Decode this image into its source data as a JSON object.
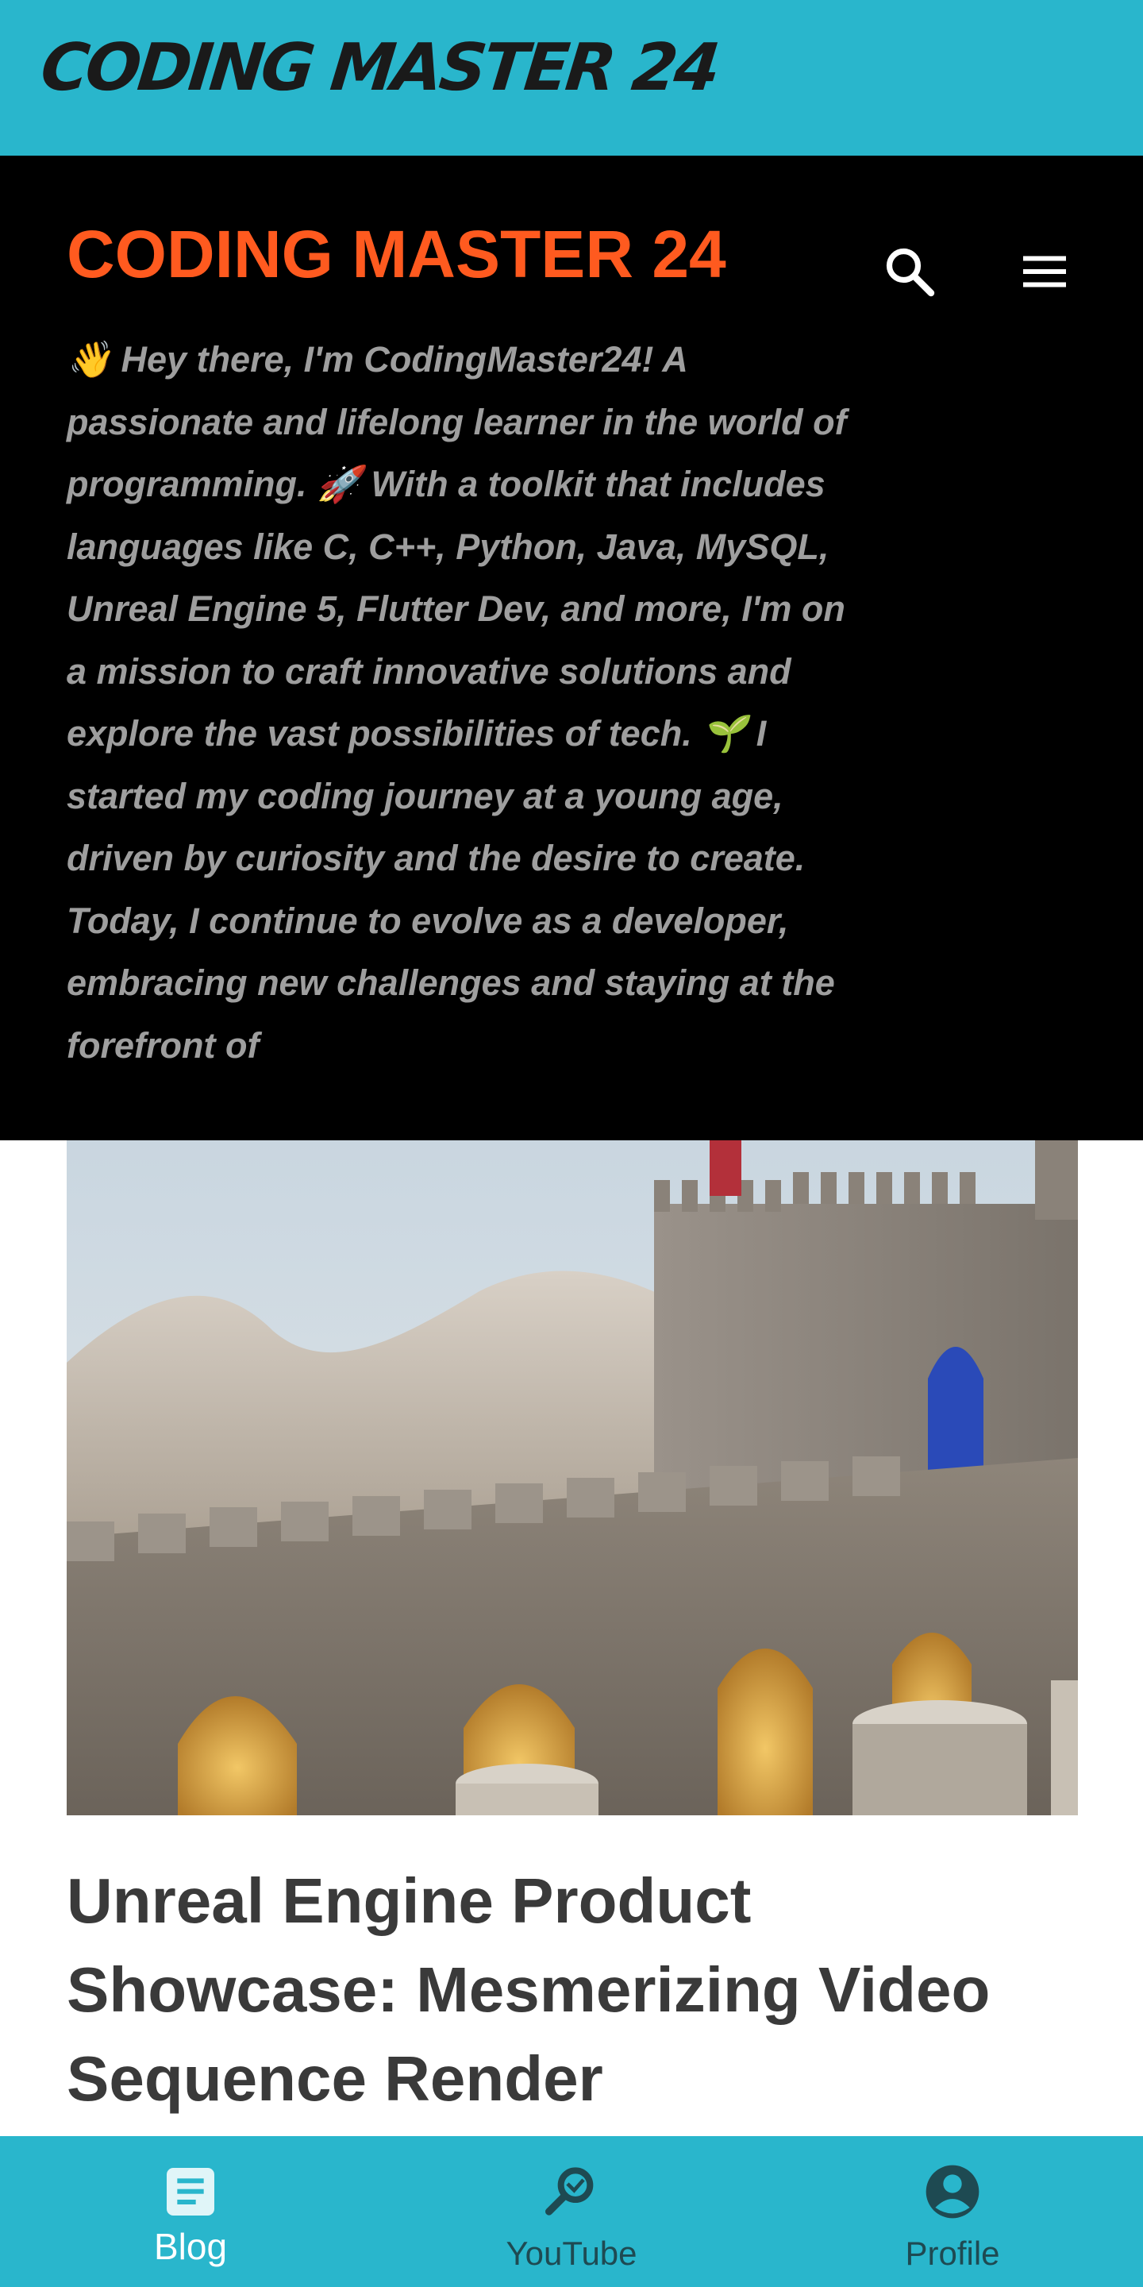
{
  "app_bar": {
    "title": "CODING MASTER 24",
    "background_color": "#29b6cc"
  },
  "hero": {
    "blog_title": "CODING MASTER 24",
    "title_color": "#ff5a1f",
    "description": "👋 Hey there, I'm CodingMaster24! A passionate and lifelong learner in the world of programming. 🚀 With a toolkit that includes languages like C, C++, Python, Java, MySQL, Unreal Engine 5, Flutter Dev, and more, I'm on a mission to craft innovative solutions and explore the vast possibilities of tech.  🌱 I started my coding journey at a young age, driven by curiosity and the desire to create. Today, I continue to evolve as a developer, embracing new challenges and staying at the forefront of",
    "icons": [
      "search-icon",
      "menu-icon"
    ]
  },
  "post": {
    "image_description_icon": "castle-image",
    "title": "Unreal Engine Product Showcase: Mesmerizing Video Sequence Render"
  },
  "bottom_nav": {
    "items": [
      {
        "label": "Blog",
        "icon": "article-icon",
        "active": true
      },
      {
        "label": "YouTube",
        "icon": "search-icon",
        "active": false
      },
      {
        "label": "Profile",
        "icon": "account-circle-icon",
        "active": false
      }
    ]
  }
}
